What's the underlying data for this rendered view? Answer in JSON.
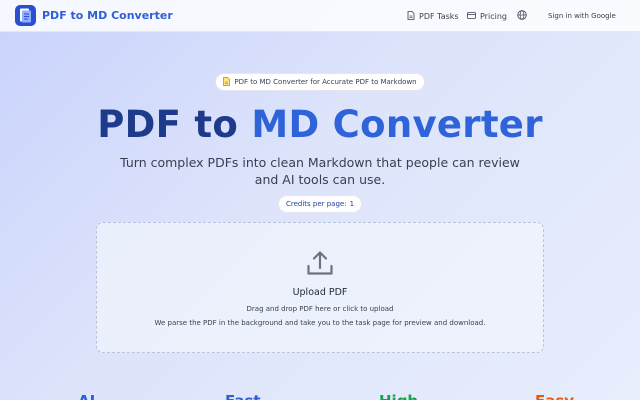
{
  "header": {
    "brand": "PDF to MD Converter",
    "nav": {
      "tasks": "PDF Tasks",
      "pricing": "Pricing",
      "signin": "Sign in with Google"
    }
  },
  "hero": {
    "pill": "PDF to MD Converter for Accurate PDF to Markdown",
    "title_part1": "PDF to",
    "title_part2": "MD Converter",
    "subtitle": "Turn complex PDFs into clean Markdown that people can review and AI tools can use.",
    "credits_label": "Credits per page:",
    "credits_value": "1"
  },
  "upload": {
    "label": "Upload PDF",
    "hint": "Drag and drop PDF here or click to upload",
    "description": "We parse the PDF in the background and take you to the task page for preview and download."
  },
  "features": [
    {
      "title": "AI",
      "color": "#2f5fd6"
    },
    {
      "title": "Fast",
      "color": "#2f5fd6"
    },
    {
      "title": "High",
      "color": "#16a34a"
    },
    {
      "title": "Easy",
      "color": "#ea580c"
    }
  ],
  "icons": {
    "logo": "document-logo-icon",
    "tasks": "document-icon",
    "pricing": "card-icon",
    "language": "globe-icon",
    "pill": "document-icon",
    "upload": "upload-icon"
  },
  "colors": {
    "brand": "#2f5fd6",
    "title_dark": "#1e3a8a",
    "title_accent": "#2f63d9"
  }
}
